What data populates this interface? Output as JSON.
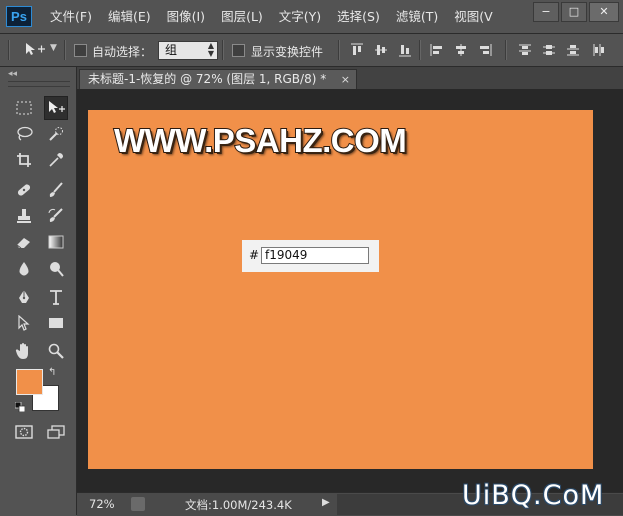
{
  "app": {
    "logo": "Ps"
  },
  "menu": {
    "items": [
      "文件(F)",
      "编辑(E)",
      "图像(I)",
      "图层(L)",
      "文字(Y)",
      "选择(S)",
      "滤镜(T)",
      "视图(V"
    ]
  },
  "window_controls": {
    "minimize": "−",
    "maximize": "□",
    "close": "✕"
  },
  "options_bar": {
    "auto_select_label": "自动选择：",
    "auto_select_checked": false,
    "auto_select_target": "组",
    "show_transform_label": "显示变换控件",
    "show_transform_checked": false
  },
  "document": {
    "tab_title": "未标题-1-恢复的 @ 72% (图层 1, RGB/8) *",
    "close": "×"
  },
  "canvas": {
    "background_color": "#f19049",
    "watermark_text": "WWW.PSAHZ.COM",
    "hex_label": "#",
    "hex_value": "f19049"
  },
  "colors": {
    "foreground": "#f19049",
    "background": "#ffffff"
  },
  "status": {
    "zoom": "72%",
    "doc_info": "文档:1.00M/243.4K",
    "arrow": "▶"
  },
  "site_watermark": "UiBQ.CoM",
  "tools": [
    "marquee-tool",
    "move-tool",
    "lasso-tool",
    "quick-selection-tool",
    "crop-tool",
    "eyedropper-tool",
    "spot-healing-tool",
    "brush-tool",
    "clone-stamp-tool",
    "history-brush-tool",
    "eraser-tool",
    "gradient-tool",
    "blur-tool",
    "dodge-tool",
    "pen-tool",
    "type-tool",
    "path-selection-tool",
    "rectangle-tool",
    "hand-tool",
    "zoom-tool"
  ]
}
